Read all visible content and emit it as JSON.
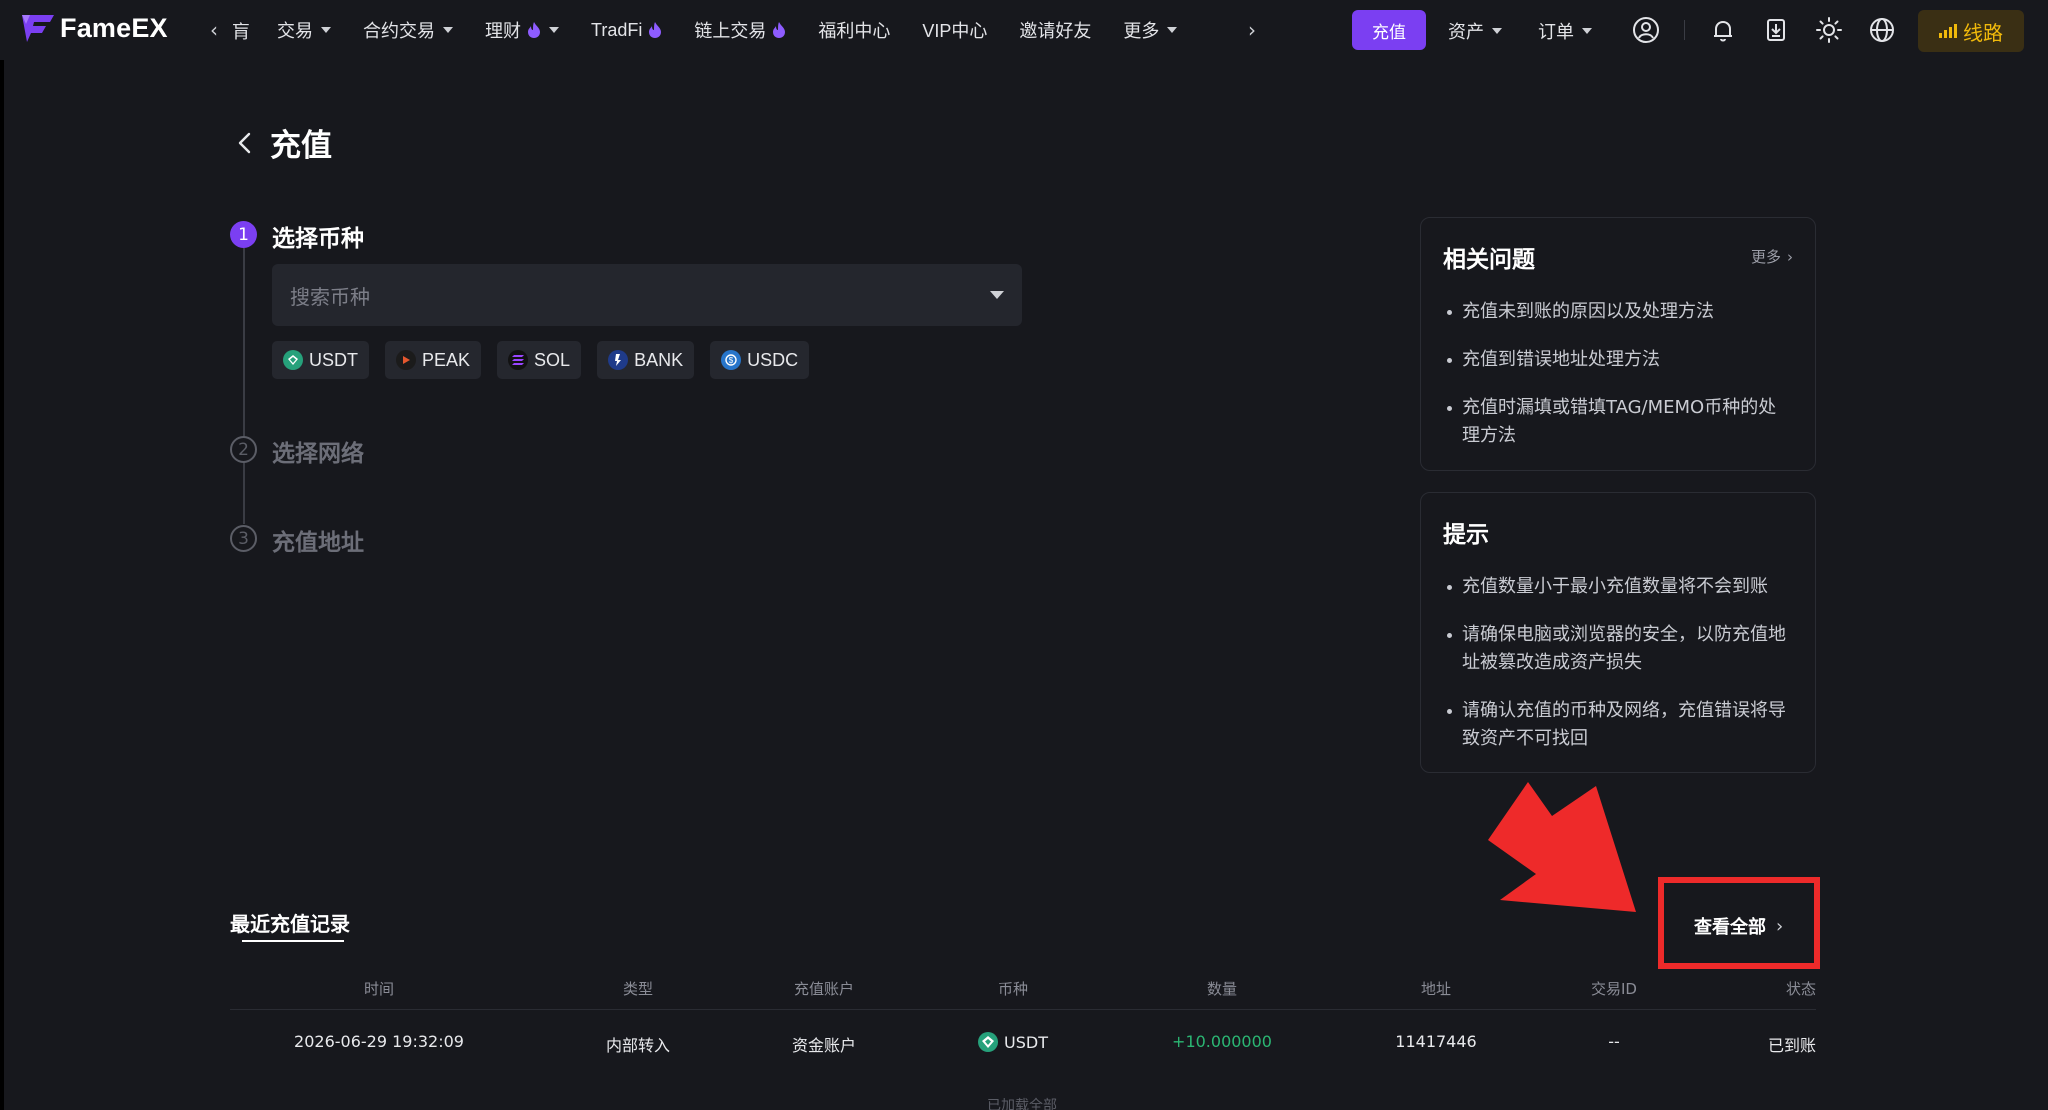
{
  "app": {
    "logo_text": "FameEX"
  },
  "nav": {
    "truncated_label": "肓",
    "items": [
      {
        "label": "交易",
        "dropdown": true,
        "hot": false
      },
      {
        "label": "合约交易",
        "dropdown": true,
        "hot": false
      },
      {
        "label": "理财",
        "dropdown": true,
        "hot": true
      },
      {
        "label": "TradFi",
        "dropdown": false,
        "hot": true
      },
      {
        "label": "链上交易",
        "dropdown": false,
        "hot": true
      },
      {
        "label": "福利中心",
        "dropdown": false,
        "hot": false
      },
      {
        "label": "VIP中心",
        "dropdown": false,
        "hot": false
      },
      {
        "label": "邀请好友",
        "dropdown": false,
        "hot": false
      },
      {
        "label": "更多",
        "dropdown": true,
        "hot": false
      }
    ],
    "deposit_label": "充值",
    "assets_label": "资产",
    "orders_label": "订单",
    "route_label": "线路",
    "icons": [
      "user-icon",
      "bell-icon",
      "download-icon",
      "sun-icon",
      "globe-icon"
    ],
    "accent_color": "#7b3ff2",
    "route_color": "#f0b90b"
  },
  "page": {
    "title": "充值"
  },
  "steps": [
    {
      "num": "1",
      "label": "选择币种",
      "active": true
    },
    {
      "num": "2",
      "label": "选择网络",
      "active": false
    },
    {
      "num": "3",
      "label": "充值地址",
      "active": false
    }
  ],
  "search": {
    "placeholder": "搜索币种"
  },
  "coins": [
    {
      "symbol": "USDT",
      "color": "#26a17b"
    },
    {
      "symbol": "PEAK",
      "color": "#e4572e"
    },
    {
      "symbol": "SOL",
      "color": "#9945ff"
    },
    {
      "symbol": "BANK",
      "color": "#1f3b8a"
    },
    {
      "symbol": "USDC",
      "color": "#2775ca"
    }
  ],
  "faq": {
    "title": "相关问题",
    "more_label": "更多",
    "items": [
      "充值未到账的原因以及处理方法",
      "充值到错误地址处理方法",
      "充值时漏填或错填TAG/MEMO币种的处理方法"
    ]
  },
  "tips": {
    "title": "提示",
    "items": [
      "充值数量小于最小充值数量将不会到账",
      "请确保电脑或浏览器的安全，以防充值地址被篡改造成资产损失",
      "请确认充值的币种及网络，充值错误将导致资产不可找回"
    ]
  },
  "records": {
    "title": "最近充值记录",
    "view_all_label": "查看全部",
    "columns": [
      "时间",
      "类型",
      "充值账户",
      "币种",
      "数量",
      "地址",
      "交易ID",
      "状态"
    ],
    "rows": [
      {
        "time": "2026-06-29 19:32:09",
        "type": "内部转入",
        "account": "资金账户",
        "coin": "USDT",
        "amount": "+10.000000",
        "address": "11417446",
        "txid": "--",
        "status": "已到账"
      }
    ],
    "footer": "已加载全部"
  },
  "annotation": {
    "color": "#ee2a2a"
  }
}
